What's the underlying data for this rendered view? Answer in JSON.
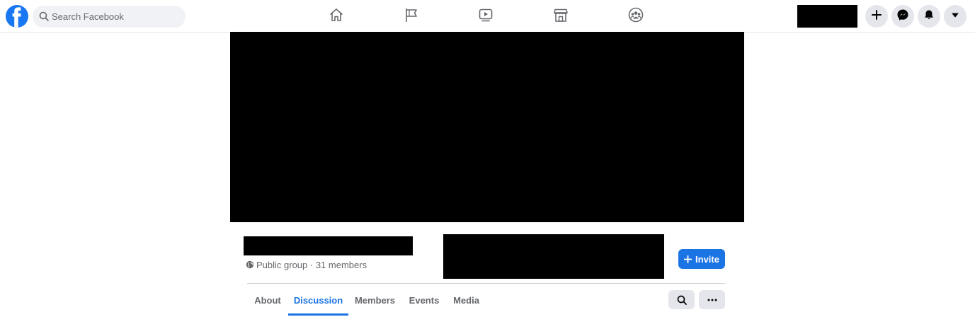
{
  "topbar": {
    "search": {
      "placeholder": "Search Facebook",
      "value": ""
    },
    "nav": [
      {
        "name": "home-nav",
        "icon": "home-icon"
      },
      {
        "name": "pages-nav",
        "icon": "flag-icon"
      },
      {
        "name": "watch-nav",
        "icon": "video-play-icon"
      },
      {
        "name": "marketplace-nav",
        "icon": "storefront-icon"
      },
      {
        "name": "groups-nav",
        "icon": "groups-icon"
      }
    ],
    "right_buttons": [
      {
        "name": "create-button",
        "icon": "plus-icon"
      },
      {
        "name": "messenger-button",
        "icon": "messenger-icon"
      },
      {
        "name": "notifications-button",
        "icon": "bell-icon"
      },
      {
        "name": "account-menu-button",
        "icon": "caret-down-icon"
      }
    ]
  },
  "group": {
    "meta": "Public group · 31 members",
    "meta_icon": "globe-icon",
    "invite_label": "Invite"
  },
  "tabs": [
    {
      "label": "About",
      "active": false
    },
    {
      "label": "Discussion",
      "active": true
    },
    {
      "label": "Members",
      "active": false
    },
    {
      "label": "Events",
      "active": false
    },
    {
      "label": "Media",
      "active": false
    }
  ],
  "actions": [
    {
      "name": "group-search-button",
      "icon": "search-icon"
    },
    {
      "name": "more-options-button",
      "icon": "ellipsis-icon"
    }
  ],
  "colors": {
    "brand": "#1877f2",
    "accent": "#1b74e4",
    "button_bg": "#e4e6eb",
    "search_bg": "#f0f2f5",
    "text_secondary": "#65676b"
  }
}
